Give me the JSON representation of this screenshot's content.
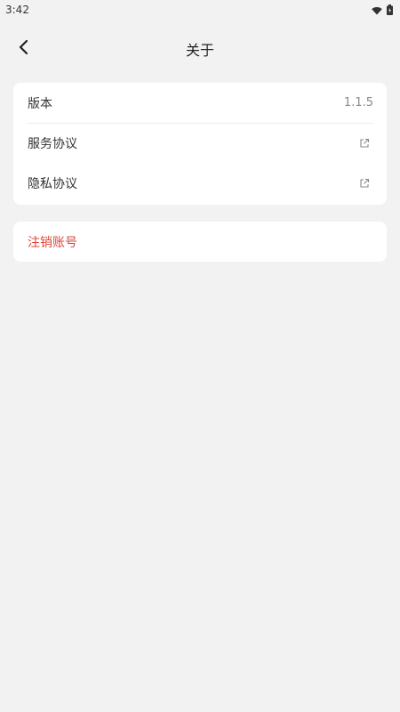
{
  "status_bar": {
    "time": "3:42",
    "icons": [
      "wifi-icon",
      "battery-icon"
    ]
  },
  "header": {
    "title": "关于",
    "back_icon": "chevron-left-icon"
  },
  "about_list": {
    "items": [
      {
        "label": "版本",
        "value": "1.1.5"
      },
      {
        "label": "服务协议",
        "icon": "external-link-icon"
      },
      {
        "label": "隐私协议",
        "icon": "external-link-icon"
      }
    ]
  },
  "danger": {
    "delete_account_label": "注销账号",
    "color": "#d9473a"
  },
  "colors": {
    "background": "#f2f2f2",
    "card": "#ffffff",
    "text": "#333333",
    "muted": "#888888"
  }
}
